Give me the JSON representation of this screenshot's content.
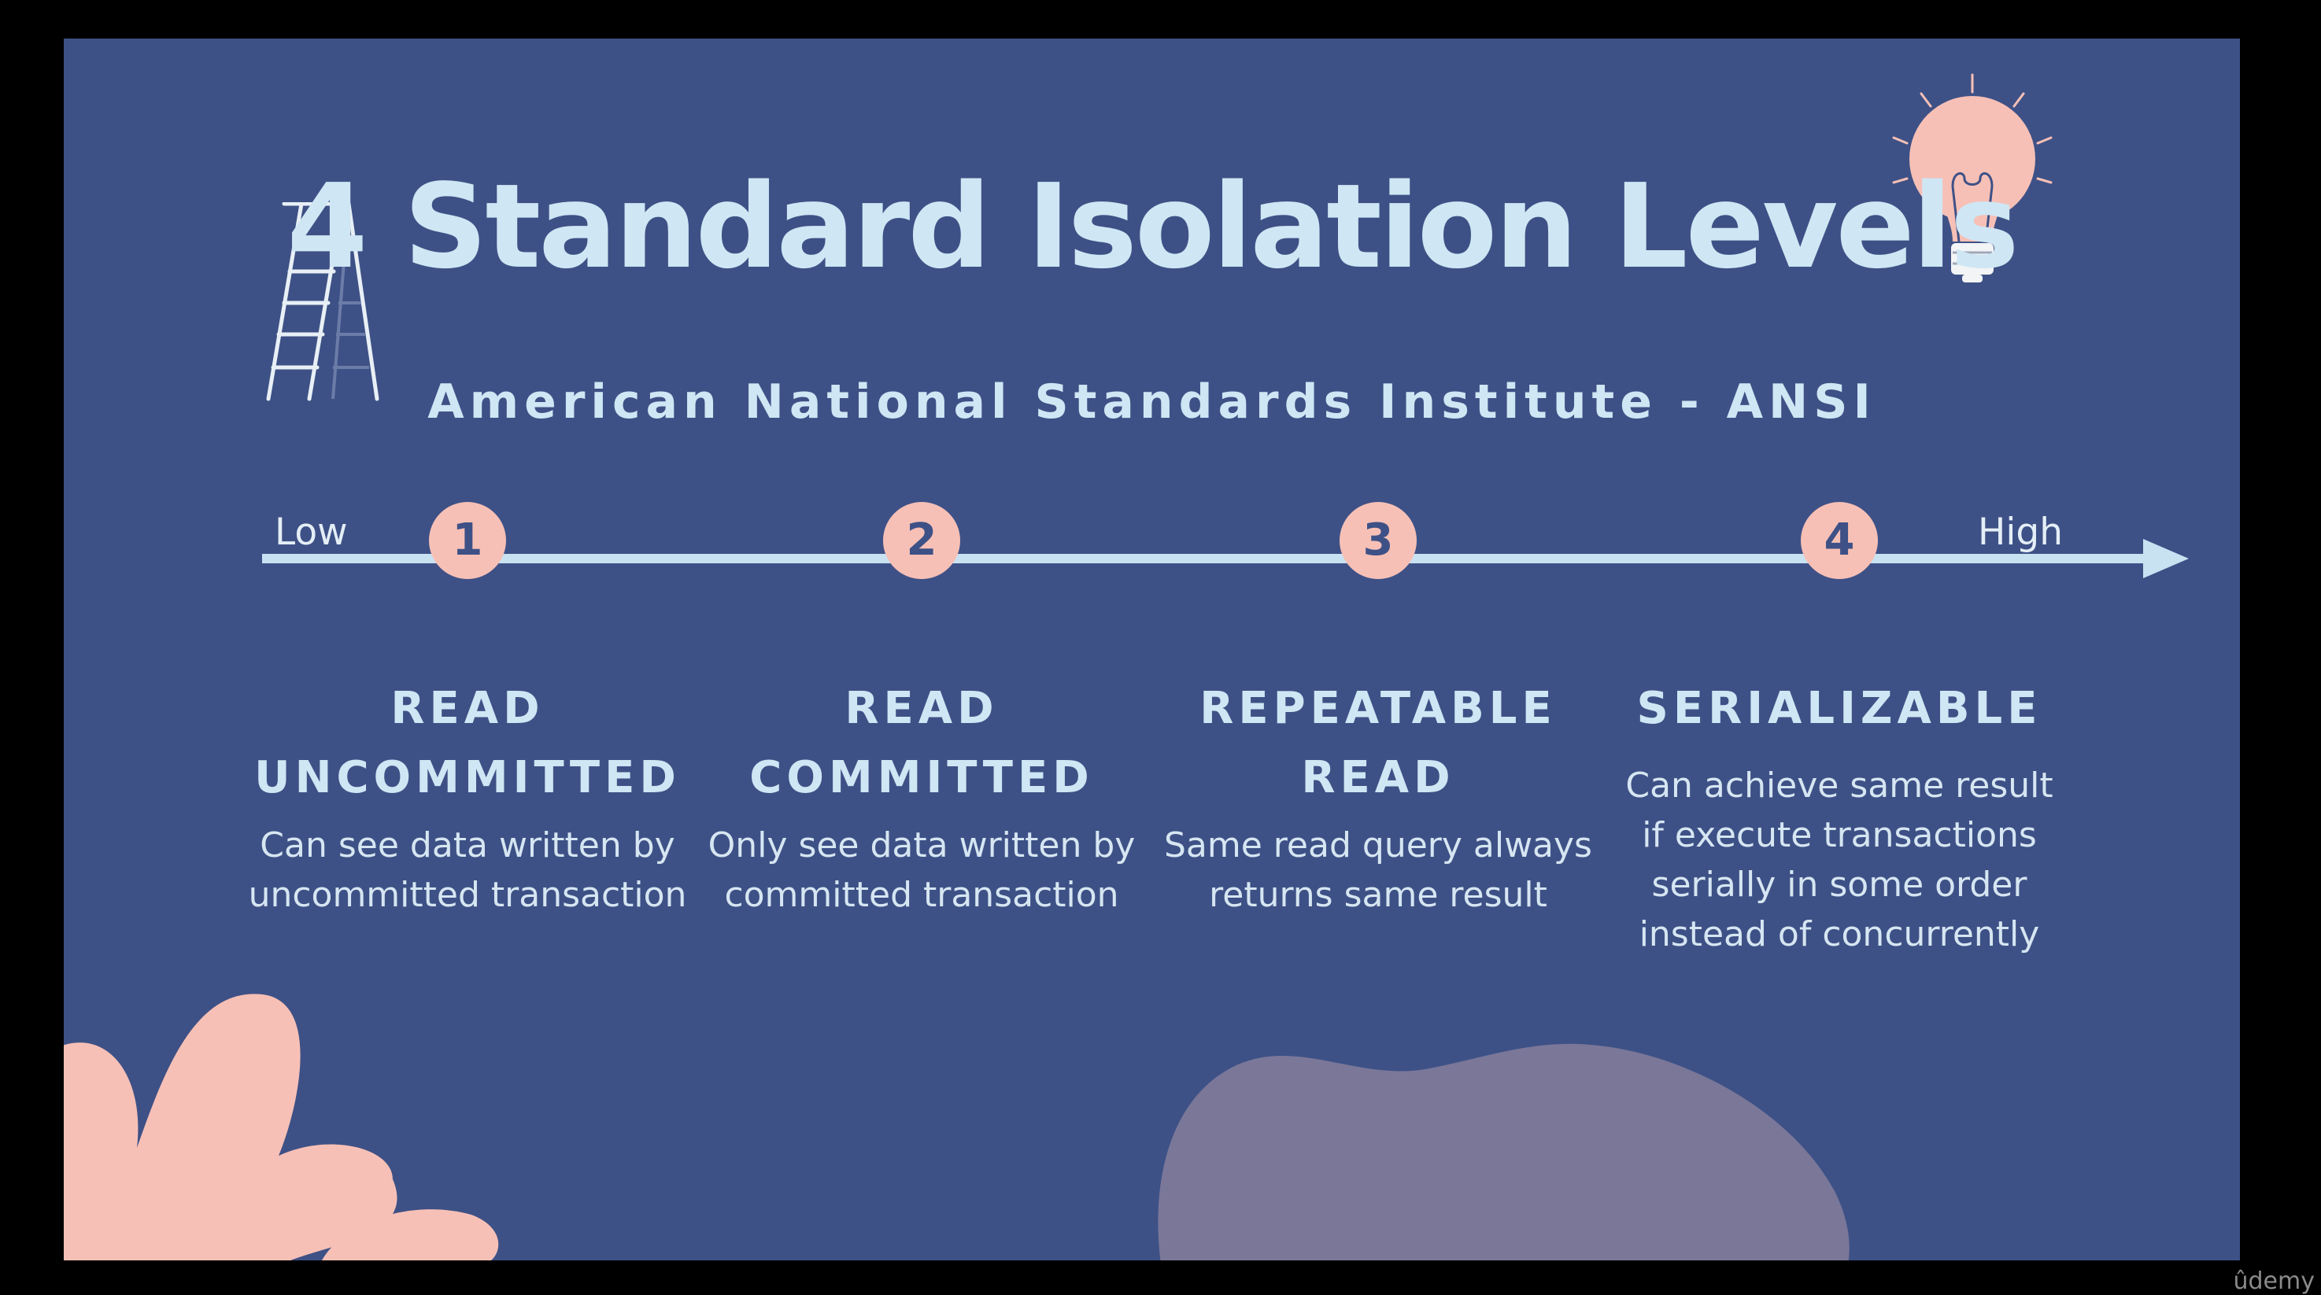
{
  "slide": {
    "title": "4 Standard Isolation Levels",
    "subtitle": "American National Standards Institute - ANSI",
    "axis": {
      "low_label": "Low",
      "high_label": "High"
    },
    "levels": [
      {
        "number": "1",
        "name": "READ\nUNCOMMITTED",
        "description": "Can see data written by\nuncommitted transaction"
      },
      {
        "number": "2",
        "name": "READ\nCOMMITTED",
        "description": "Only see data written by\ncommitted transaction"
      },
      {
        "number": "3",
        "name": "REPEATABLE\nREAD",
        "description": "Same read query always\nreturns same result"
      },
      {
        "number": "4",
        "name": "SERIALIZABLE",
        "description": "Can achieve same result\nif execute transactions\nserially in some order\ninstead of concurrently"
      }
    ],
    "icons": [
      "ladder-icon",
      "light-bulb-icon"
    ]
  },
  "watermark": "ûdemy",
  "colors": {
    "background": "#3e5186",
    "text": "#cfe6f4",
    "accent": "#f7c0b6",
    "blob": "#7a7799"
  }
}
